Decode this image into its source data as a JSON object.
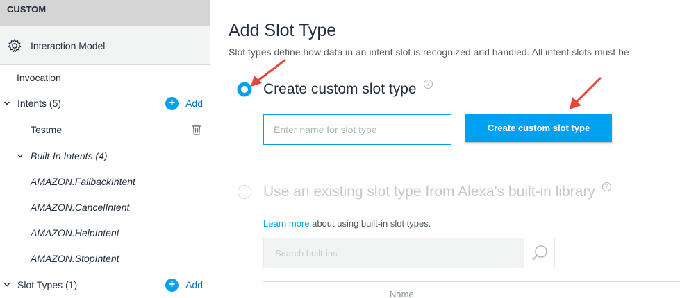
{
  "sidebar": {
    "section_label": "CUSTOM",
    "model_label": "Interaction Model",
    "invocation_label": "Invocation",
    "intents_label": "Intents (5)",
    "intents_add": "Add",
    "intent_custom": "Testme",
    "builtin_label": "Built-In Intents (4)",
    "builtin_items": [
      "AMAZON.FallbackIntent",
      "AMAZON.CancelIntent",
      "AMAZON.HelpIntent",
      "AMAZON.StopIntent"
    ],
    "slot_types_label": "Slot Types (1)",
    "slot_types_add": "Add"
  },
  "main": {
    "title": "Add Slot Type",
    "description": "Slot types define how data in an intent slot is recognized and handled. All intent slots must be",
    "option_custom_label": "Create custom slot type",
    "name_placeholder": "Enter name for slot type",
    "create_button": "Create custom slot type",
    "option_builtin_label": "Use an existing slot type from Alexa's built-in library",
    "learn_more_link": "Learn more",
    "learn_more_rest": " about using built-in slot types.",
    "search_placeholder": "Search built-ins",
    "column_name": "Name",
    "help_glyph": "?"
  },
  "colors": {
    "accent": "#00a1f1",
    "arrow": "#e8453c",
    "sidebar_header": "#d5d5d5"
  },
  "icons": {
    "model": "gear-icon",
    "add": "plus-circle-icon",
    "delete": "trash-icon",
    "expand": "chevron-down-icon",
    "search": "search-icon"
  }
}
